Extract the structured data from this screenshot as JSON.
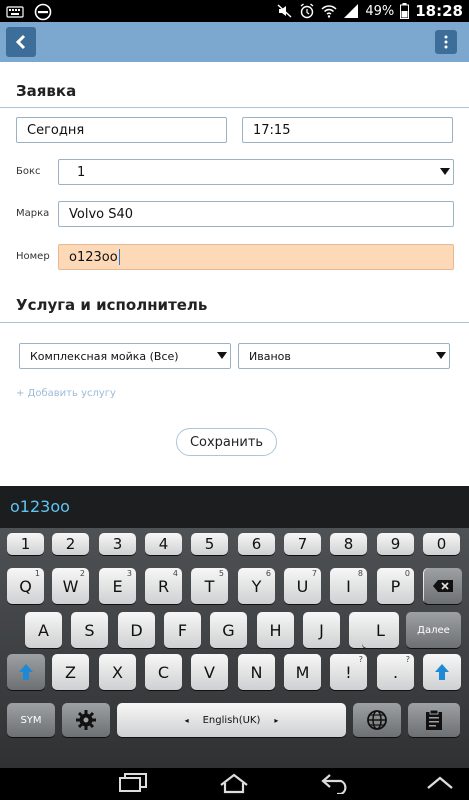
{
  "status_bar": {
    "battery": "49%",
    "time": "18:28",
    "icons_left": [
      "keyboard-icon",
      "no-entry-icon"
    ],
    "icons_right": [
      "mute-icon",
      "alarm-icon",
      "wifi-icon",
      "signal-icon",
      "battery-icon"
    ]
  },
  "action_bar": {
    "back_icon": "chevron-left-icon",
    "menu_icon": "overflow-menu-icon"
  },
  "form": {
    "section1_title": "Заявка",
    "date_value": "Сегодня",
    "time_value": "17:15",
    "box_label": "Бокс",
    "box_value": "1",
    "brand_label": "Марка",
    "brand_value": "Volvo S40",
    "number_label": "Номер",
    "number_value": "о123оо",
    "section2_title": "Услуга и исполнитель",
    "service_value": "Комплексная мойка (Все)",
    "executor_value": "Иванов",
    "add_service_link": "+ Добавить услугу",
    "save_label": "Сохранить"
  },
  "keyboard": {
    "candidate": "о123оо",
    "row_numbers": [
      "1",
      "2",
      "3",
      "4",
      "5",
      "6",
      "7",
      "8",
      "9",
      "0"
    ],
    "row1": [
      "Q",
      "W",
      "E",
      "R",
      "T",
      "Y",
      "U",
      "I",
      "O",
      "P"
    ],
    "row2": [
      "A",
      "S",
      "D",
      "F",
      "G",
      "H",
      "J",
      "K",
      "L"
    ],
    "enter_label": "Далее",
    "row3": [
      "Z",
      "X",
      "C",
      "V",
      "B",
      "N",
      "M"
    ],
    "punct1": "!",
    "punct1_alt": "?",
    "punct2": ".",
    "punct2_alt": "?",
    "sym_label": "SYM",
    "language_label": "English(UK)",
    "key_hints": {
      "Q": "1",
      "W": "2",
      "E": "3",
      "R": "4",
      "T": "5",
      "Y": "6",
      "U": "7",
      "I": "8",
      "O": "9",
      "P": "0"
    }
  },
  "colors": {
    "action_bar": "#7ca7cf",
    "button_dark": "#3d6d99",
    "highlight_field": "#fed9b7",
    "candidate_text": "#5cc6f4"
  }
}
